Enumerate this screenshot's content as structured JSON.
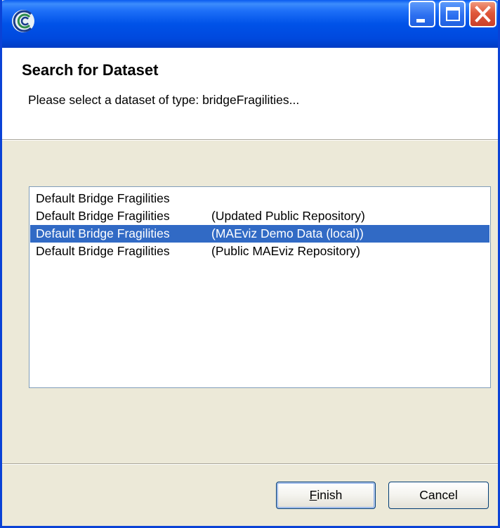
{
  "window": {
    "title": "",
    "icon": "app-swirl-icon",
    "controls": {
      "minimize": "minimize-icon",
      "maximize": "maximize-icon",
      "close": "close-icon"
    }
  },
  "header": {
    "title": "Search for Dataset",
    "description": "Please select a dataset of type: bridgeFragilities..."
  },
  "datasets": {
    "items": [
      {
        "name": "Default Bridge Fragilities",
        "source": ""
      },
      {
        "name": "Default Bridge Fragilities",
        "source": "(Updated Public Repository)"
      },
      {
        "name": "Default Bridge Fragilities",
        "source": "(MAEviz Demo Data (local))"
      },
      {
        "name": "Default Bridge Fragilities",
        "source": "(Public MAEviz Repository)"
      }
    ],
    "selected_index": 2
  },
  "buttons": {
    "finish": {
      "mnemonic": "F",
      "rest": "inish"
    },
    "cancel": "Cancel"
  },
  "colors": {
    "titlebar": "#0052E8",
    "selection": "#316AC5",
    "dialog_bg": "#ECE9D8",
    "close_button": "#E0583A"
  }
}
